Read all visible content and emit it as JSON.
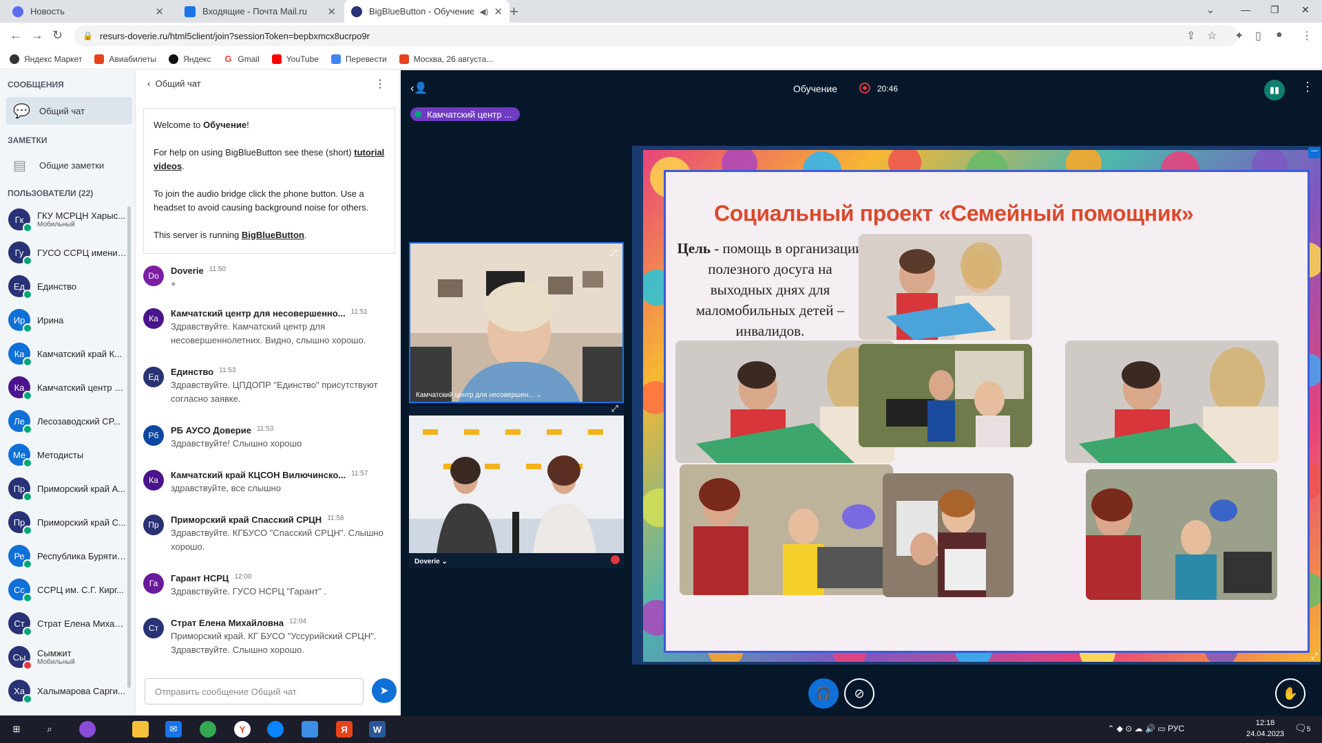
{
  "browser": {
    "tabs": [
      {
        "title": "Новость",
        "icon": "news-icon",
        "color": "#5b6cf0"
      },
      {
        "title": "Входящие - Почта Mail.ru",
        "icon": "mail-icon",
        "color": "#1a73e8"
      },
      {
        "title": "BigBlueButton - Обучение",
        "icon": "bbb-icon",
        "color": "#283274"
      }
    ],
    "url": "resurs-doverie.ru/html5client/join?sessionToken=bepbxmcx8ucrpo9r",
    "bookmarks": [
      {
        "label": "Яндекс Маркет",
        "color": "#333"
      },
      {
        "label": "Авиабилеты",
        "color": "#e8421c"
      },
      {
        "label": "Яндекс",
        "color": "#111"
      },
      {
        "label": "Gmail",
        "color": "#ea4335"
      },
      {
        "label": "YouTube",
        "color": "#ff0000"
      },
      {
        "label": "Перевести",
        "color": "#4285f4"
      },
      {
        "label": "Москва, 26 августа...",
        "color": "#e8421c"
      }
    ]
  },
  "sidebar": {
    "messages_header": "СООБЩЕНИЯ",
    "public_chat": "Общий чат",
    "notes_header": "ЗАМЕТКИ",
    "shared_notes": "Общие заметки",
    "users_header": "ПОЛЬЗОВАТЕЛИ (22)",
    "users": [
      {
        "initials": "Гк",
        "name": "ГКУ МСРЦН Харыс...",
        "sub": "Мобильный",
        "color": "#283274",
        "mic": "green"
      },
      {
        "initials": "Гу",
        "name": "ГУСО ССРЦ имени ...",
        "sub": "",
        "color": "#283274",
        "mic": "green"
      },
      {
        "initials": "Ед",
        "name": "Единство",
        "sub": "",
        "color": "#283274",
        "mic": "green"
      },
      {
        "initials": "Ир",
        "name": "Ирина",
        "sub": "",
        "color": "#0f70d7",
        "mic": "green"
      },
      {
        "initials": "Ка",
        "name": "Камчатский край К...",
        "sub": "",
        "color": "#0f70d7",
        "mic": "green"
      },
      {
        "initials": "Ка",
        "name": "Камчатский центр д...",
        "sub": "",
        "color": "#4a148c",
        "mic": "green"
      },
      {
        "initials": "Ле",
        "name": "Лесозаводский СР...",
        "sub": "",
        "color": "#0f70d7",
        "mic": "green"
      },
      {
        "initials": "Ме",
        "name": "Методисты",
        "sub": "",
        "color": "#0f70d7",
        "mic": "green"
      },
      {
        "initials": "Пр",
        "name": "Приморский край А...",
        "sub": "",
        "color": "#283274",
        "mic": "green"
      },
      {
        "initials": "Пр",
        "name": "Приморский край С...",
        "sub": "",
        "color": "#283274",
        "mic": "green"
      },
      {
        "initials": "Ре",
        "name": "Республика Бурятия...",
        "sub": "",
        "color": "#0f70d7",
        "mic": "green"
      },
      {
        "initials": "Сс",
        "name": "ССРЦ им. С.Г. Кирг...",
        "sub": "",
        "color": "#0f70d7",
        "mic": "green"
      },
      {
        "initials": "Ст",
        "name": "Страт Елена Михай...",
        "sub": "",
        "color": "#283274",
        "mic": "green"
      },
      {
        "initials": "Сы",
        "name": "Сымжит",
        "sub": "Мобильный",
        "color": "#283274",
        "mic": "red"
      },
      {
        "initials": "Ха",
        "name": "Халымарова Сарги...",
        "sub": "",
        "color": "#283274",
        "mic": "green"
      }
    ]
  },
  "chat": {
    "header": "Общий чат",
    "welcome_prefix": "Welcome to ",
    "welcome_room": "Обучение",
    "welcome_suffix": "!",
    "help_prefix": "For help on using BigBlueButton see these (short) ",
    "help_link": "tutorial videos",
    "help_suffix": ".",
    "audio_text": "To join the audio bridge click the phone button. Use a headset to avoid causing background noise for others.",
    "server_prefix": "This server is running ",
    "server_link": "BigBlueButton",
    "server_suffix": ".",
    "messages": [
      {
        "initials": "Do",
        "name": "Doverie",
        "time": "11:50",
        "text": "+",
        "color": "#7b1fa2"
      },
      {
        "initials": "Ка",
        "name": "Камчатский центр для несовершенно...",
        "time": "11:51",
        "text": "Здравствуйте. Камчатский центр для несовершеннолетних. Видно, слышно хорошо.",
        "color": "#4a148c"
      },
      {
        "initials": "Ед",
        "name": "Единство",
        "time": "11:53",
        "text": "Здравствуйте. ЦПДОПР \"Единство\" присутствуют согласно заявке.",
        "color": "#283274"
      },
      {
        "initials": "Рб",
        "name": "РБ АУСО Доверие",
        "time": "11:53",
        "text": "Здравствуйте! Слышно хорошо",
        "color": "#0d47a1"
      },
      {
        "initials": "Ка",
        "name": "Камчатский край КЦСОН Вилючинско...",
        "time": "11:57",
        "text": "здравствуйте, все слышно",
        "color": "#4a148c"
      },
      {
        "initials": "Пр",
        "name": "Приморский край Спасский СРЦН",
        "time": "11:58",
        "text": "Здравствуйте. КГБУСО \"Спасский СРЦН\". Слышно хорошо.",
        "color": "#283274"
      },
      {
        "initials": "Га",
        "name": "Гарант НСРЦ",
        "time": "12:00",
        "text": "Здравствуйте. ГУСО НСРЦ \"Гарант\" .",
        "color": "#6a1b9a"
      },
      {
        "initials": "Ст",
        "name": "Страт Елена Михайловна",
        "time": "12:04",
        "text": "Приморский край. КГ БУСО \"Уссурийский СРЦН\". Здравствуйте. Слышно хорошо.",
        "color": "#283274"
      }
    ],
    "input_placeholder": "Отправить сообщение Общий чат"
  },
  "meeting": {
    "title": "Обучение",
    "rec_time": "20:46",
    "talker": "Камчатский центр ...",
    "video1_label": "Камчатский центр для несовершен... ⌄",
    "video2_label": "Doverie ⌄"
  },
  "slide": {
    "title": "Социальный проект «Семейный помощник»",
    "goal_bold": "Цель",
    "goal_text": " - помощь в организации полезного досуга на выходных днях для маломобильных детей – инвалидов."
  },
  "taskbar": {
    "lang": "РУС",
    "time": "12:18",
    "date": "24.04.2023",
    "notif_count": "5"
  }
}
